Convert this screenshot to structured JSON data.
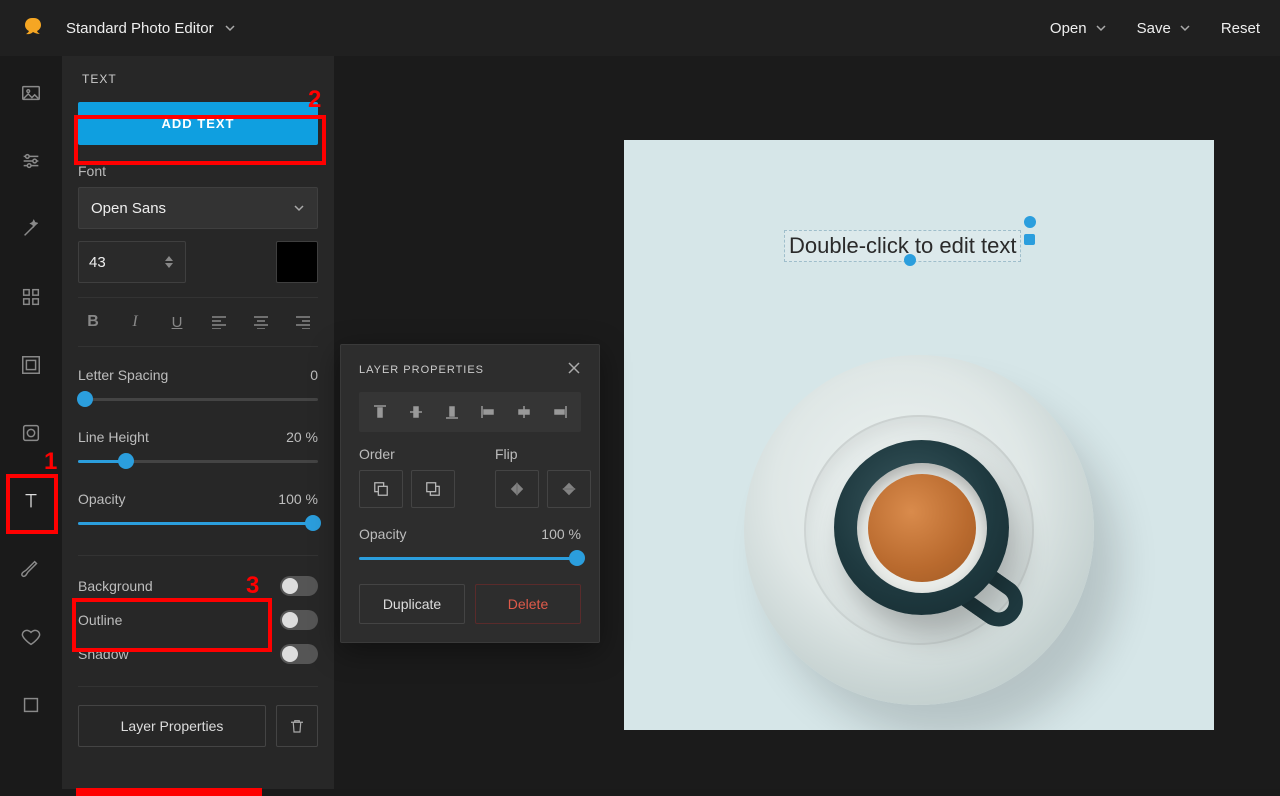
{
  "app": {
    "title": "Standard Photo Editor"
  },
  "topbar": {
    "open": "Open",
    "save": "Save",
    "reset": "Reset"
  },
  "panel": {
    "heading": "TEXT",
    "add_text": "ADD TEXT",
    "font_label": "Font",
    "font_value": "Open Sans",
    "size_value": "43",
    "letter_spacing_label": "Letter Spacing",
    "letter_spacing_value": "0",
    "line_height_label": "Line Height",
    "line_height_value": "20 %",
    "opacity_label": "Opacity",
    "opacity_value": "100 %",
    "background_label": "Background",
    "outline_label": "Outline",
    "shadow_label": "Shadow",
    "layer_properties_btn": "Layer Properties"
  },
  "layer_popup": {
    "heading": "LAYER PROPERTIES",
    "order_label": "Order",
    "flip_label": "Flip",
    "opacity_label": "Opacity",
    "opacity_value": "100 %",
    "duplicate": "Duplicate",
    "delete": "Delete"
  },
  "canvas": {
    "placeholder_text": "Double-click to edit text"
  },
  "annotations": {
    "n1": "1",
    "n2": "2",
    "n3": "3"
  }
}
